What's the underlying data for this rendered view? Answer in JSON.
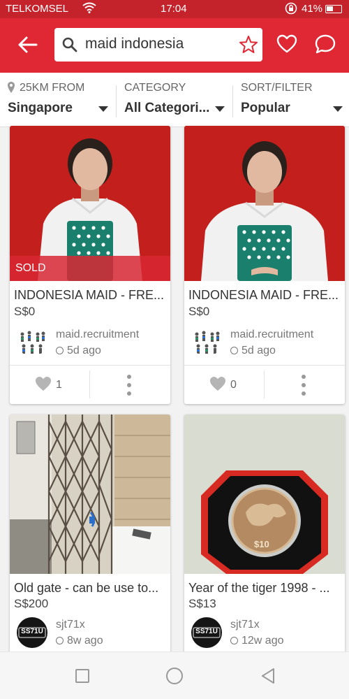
{
  "status_bar": {
    "carrier": "TELKOMSEL",
    "time": "17:04",
    "battery": "41%"
  },
  "header": {
    "search_query": "maid indonesia"
  },
  "filters": [
    {
      "label": "25KM FROM",
      "value": "Singapore"
    },
    {
      "label": "CATEGORY",
      "value": "All Categori..."
    },
    {
      "label": "SORT/FILTER",
      "value": "Popular"
    }
  ],
  "listings": [
    {
      "title": "INDONESIA MAID - FRE...",
      "price": "S$0",
      "seller": "maid.recruitment",
      "time": "5d ago",
      "likes": "1",
      "badge": "SOLD"
    },
    {
      "title": "INDONESIA MAID - FRE...",
      "price": "S$0",
      "seller": "maid.recruitment",
      "time": "5d ago",
      "likes": "0"
    },
    {
      "title": "Old gate - can be use to...",
      "price": "S$200",
      "seller": "sjt71x",
      "time": "8w ago",
      "avatar_text": "SS71U"
    },
    {
      "title": "Year of the tiger 1998 - ...",
      "price": "S$13",
      "seller": "sjt71x",
      "time": "12w ago",
      "avatar_text": "SS71U",
      "coin_text": "$10"
    }
  ],
  "colors": {
    "brand_red": "#e02734",
    "status_red": "#c4232c"
  },
  "icons": [
    "back-arrow-icon",
    "search-icon",
    "star-icon",
    "heart-icon",
    "chat-bubble-icon",
    "location-pin-icon",
    "chevron-down-icon",
    "clock-icon",
    "more-vertical-icon",
    "square-icon",
    "circle-icon",
    "triangle-back-icon"
  ]
}
